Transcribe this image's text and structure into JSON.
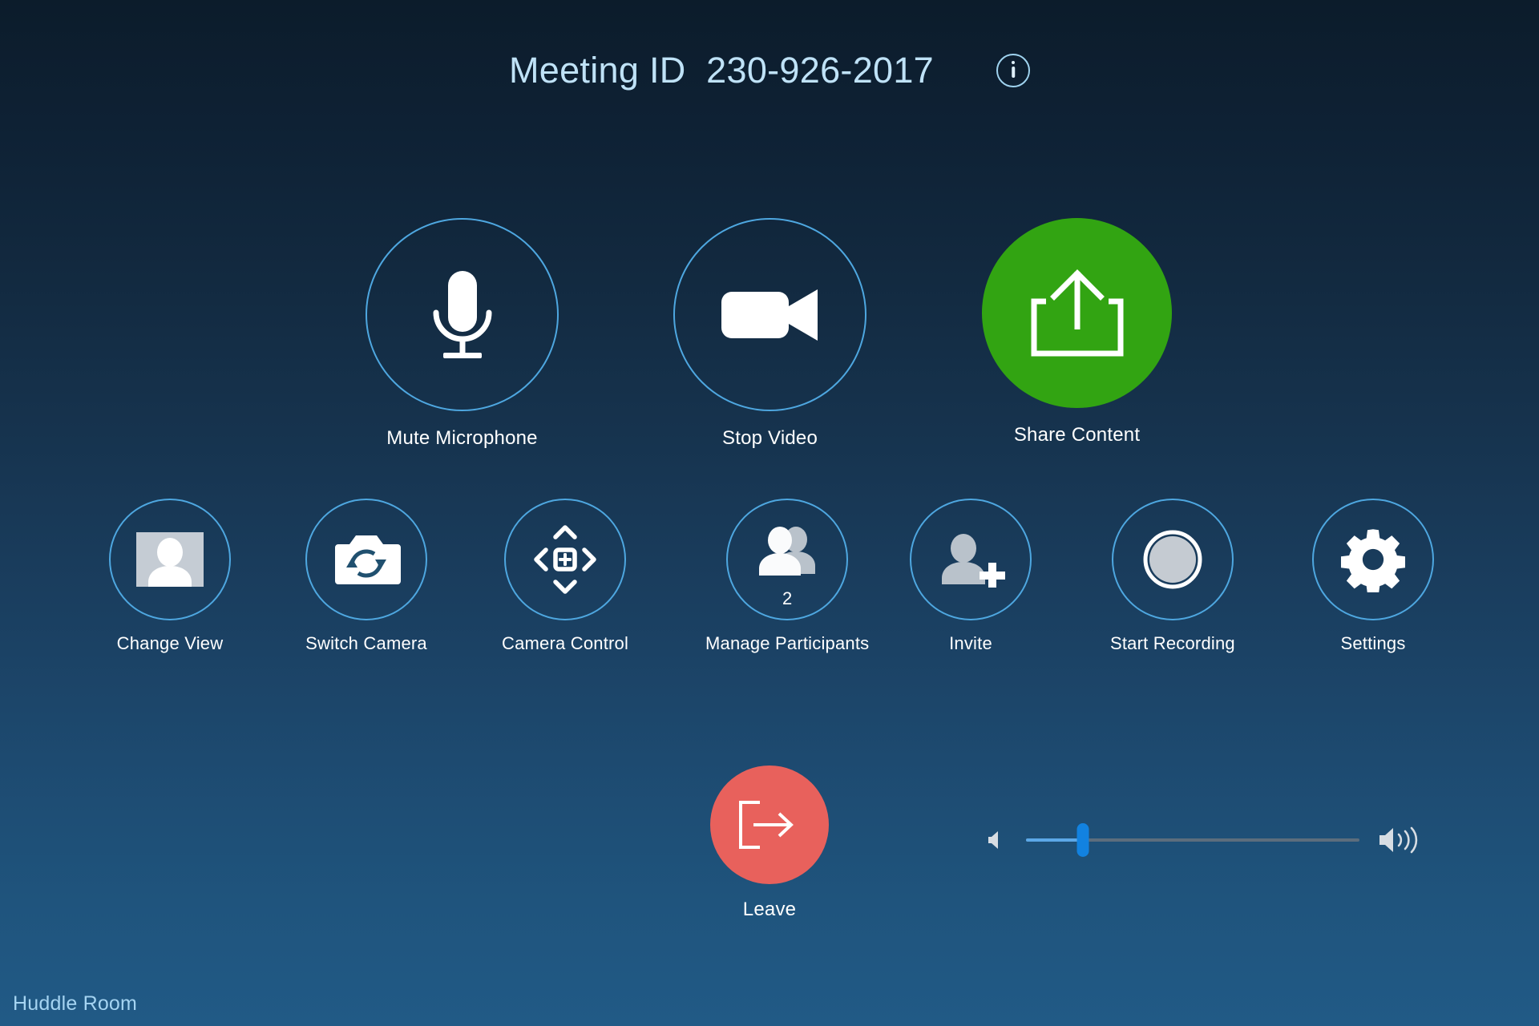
{
  "header": {
    "title": "Meeting ID  230-926-2017",
    "meeting_id": "230-926-2017",
    "info_icon": "info-icon"
  },
  "colors": {
    "background_top": "#0c1c2b",
    "background_bottom": "#215a86",
    "circle_outline": "#4ea7e0",
    "share_green": "#32a412",
    "leave_red": "#e8615c",
    "title_blue": "#bfe2f7",
    "label_white": "#ffffff",
    "room_blue": "#a5d4f2",
    "slider_fill": "#5ca8e8",
    "slider_thumb": "#1282e0",
    "slider_track": "#5c6d7d"
  },
  "primary_controls": [
    {
      "label": "Mute Microphone",
      "icon": "microphone-icon",
      "style": "outline"
    },
    {
      "label": "Stop Video",
      "icon": "video-camera-icon",
      "style": "outline"
    },
    {
      "label": "Share Content",
      "icon": "share-upload-icon",
      "style": "green"
    }
  ],
  "secondary_controls": [
    {
      "label": "Change View",
      "icon": "change-view-icon"
    },
    {
      "label": "Switch Camera",
      "icon": "switch-camera-icon"
    },
    {
      "label": "Camera Control",
      "icon": "camera-control-dpad-icon"
    },
    {
      "label": "Manage Participants",
      "icon": "participants-icon",
      "badge": "2"
    },
    {
      "label": "Invite",
      "icon": "invite-person-plus-icon"
    },
    {
      "label": "Start Recording",
      "icon": "record-circle-icon"
    },
    {
      "label": "Settings",
      "icon": "gear-icon"
    }
  ],
  "leave": {
    "label": "Leave",
    "icon": "exit-door-arrow-icon"
  },
  "volume": {
    "min_icon": "speaker-low-icon",
    "max_icon": "speaker-high-icon",
    "level_percent": 17
  },
  "footer": {
    "room_name": "Huddle Room"
  }
}
